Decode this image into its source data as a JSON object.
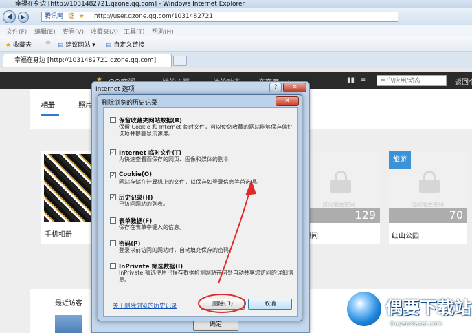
{
  "browser": {
    "window_title": "幸福在身边 [http://1031482721.qzone.qq.com] - Windows Internet Explorer",
    "site_label": "腾讯网",
    "site_badge": "证",
    "address_url": "http://user.qzone.qq.com/1031482721",
    "menu": [
      "文件(F)",
      "编辑(E)",
      "查看(V)",
      "收藏夹(A)",
      "工具(T)",
      "帮助(H)"
    ],
    "favorites_label": "收藏夹",
    "favorites_items": [
      "建议网站 ▾",
      "自定义链接"
    ],
    "tab_title": "幸福在身边 [http://1031482721.qzone.qq.com]"
  },
  "qzone": {
    "brand": "QQ空间",
    "nav": [
      "她的主页",
      "她的动态",
      "亲密度 52"
    ],
    "search_placeholder": "用户/应用/动态",
    "back_label": "返回个",
    "tabs": [
      "相册",
      "照片"
    ],
    "lock_text": "访问需要密码",
    "cards": [
      {
        "caption": "手机相册"
      },
      {
        "caption": "瞬间",
        "count": "129"
      },
      {
        "caption": "红山公园",
        "count": "70",
        "badge": "旅游"
      }
    ],
    "visitors_title": "最近访客"
  },
  "outer_dialog": {
    "title": "Internet 选项",
    "help": "?",
    "ok_label": "确定"
  },
  "dialog": {
    "title": "删除浏览的历史记录",
    "options": [
      {
        "checked": false,
        "label": "保留收藏夹网站数据(R)",
        "desc": "保留 Cookie 和 Internet 临时文件，可以使您收藏的网站能够保存偏好选项并提高显示速度。"
      },
      {
        "checked": true,
        "label": "Internet 临时文件(T)",
        "desc": "为快速查看而保存的网页、图像和媒体的副本"
      },
      {
        "checked": true,
        "label": "Cookie(O)",
        "desc": "网站存储在计算机上的文件，以保存如登录信息等首选项。"
      },
      {
        "checked": true,
        "label": "历史记录(H)",
        "desc": "已访问网站的列表。"
      },
      {
        "checked": false,
        "label": "表单数据(F)",
        "desc": "保存在表单中键入的信息。"
      },
      {
        "checked": false,
        "label": "密码(P)",
        "desc": "登录以前访问的网站时，自动填充保存的密码。"
      },
      {
        "checked": false,
        "label": "InPrivate 筛选数据(I)",
        "desc": "InPrivate 筛选使用已保存数据检测网站在何处自动共享您访问的详细信息。"
      }
    ],
    "history_link": "关于删除浏览的历史记录",
    "delete_label": "删除(D)",
    "cancel_label": "取消"
  },
  "watermark": {
    "text": "偶要下载站",
    "domain": "Ouyaoxiazai.com"
  },
  "colors": {
    "annotation_red": "#e02b2b",
    "link_blue": "#1a52b3",
    "qzone_header": "#2b2b2b"
  }
}
